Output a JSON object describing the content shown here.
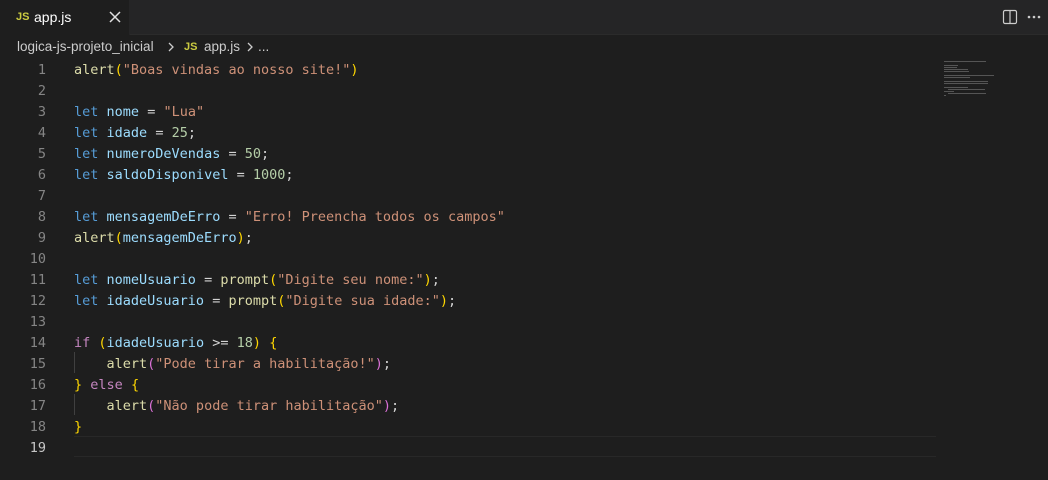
{
  "tab": {
    "icon": "js-icon",
    "icon_text": "JS",
    "label": "app.js"
  },
  "breadcrumb": {
    "folder": "logica-js-projeto_inicial",
    "icon_text": "JS",
    "file": "app.js",
    "more": "..."
  },
  "editor": {
    "active_line": 19,
    "line_numbers": [
      "1",
      "2",
      "3",
      "4",
      "5",
      "6",
      "7",
      "8",
      "9",
      "10",
      "11",
      "12",
      "13",
      "14",
      "15",
      "16",
      "17",
      "18",
      "19"
    ],
    "code": {
      "l1": [
        "alert",
        "(",
        "\"Boas vindas ao nosso site!\"",
        ")"
      ],
      "l3": [
        "let",
        "nome",
        "=",
        "\"Lua\""
      ],
      "l4": [
        "let",
        "idade",
        "=",
        "25",
        ";"
      ],
      "l5": [
        "let",
        "numeroDeVendas",
        "=",
        "50",
        ";"
      ],
      "l6": [
        "let",
        "saldoDisponivel",
        "=",
        "1000",
        ";"
      ],
      "l8": [
        "let",
        "mensagemDeErro",
        "=",
        "\"Erro! Preencha todos os campos\""
      ],
      "l9": [
        "alert",
        "(",
        "mensagemDeErro",
        ")",
        ";"
      ],
      "l11": [
        "let",
        "nomeUsuario",
        "=",
        "prompt",
        "(",
        "\"Digite seu nome:\"",
        ")",
        ";"
      ],
      "l12": [
        "let",
        "idadeUsuario",
        "=",
        "prompt",
        "(",
        "\"Digite sua idade:\"",
        ")",
        ";"
      ],
      "l14": [
        "if",
        "(",
        "idadeUsuario",
        ">=",
        "18",
        ")",
        "{"
      ],
      "l15": [
        "alert",
        "(",
        "\"Pode tirar a habilitação!\"",
        ")",
        ";"
      ],
      "l16": [
        "}",
        "else",
        "{"
      ],
      "l17": [
        "alert",
        "(",
        "\"Não pode tirar habilitação\"",
        ")",
        ";"
      ],
      "l18": [
        "}"
      ]
    }
  }
}
